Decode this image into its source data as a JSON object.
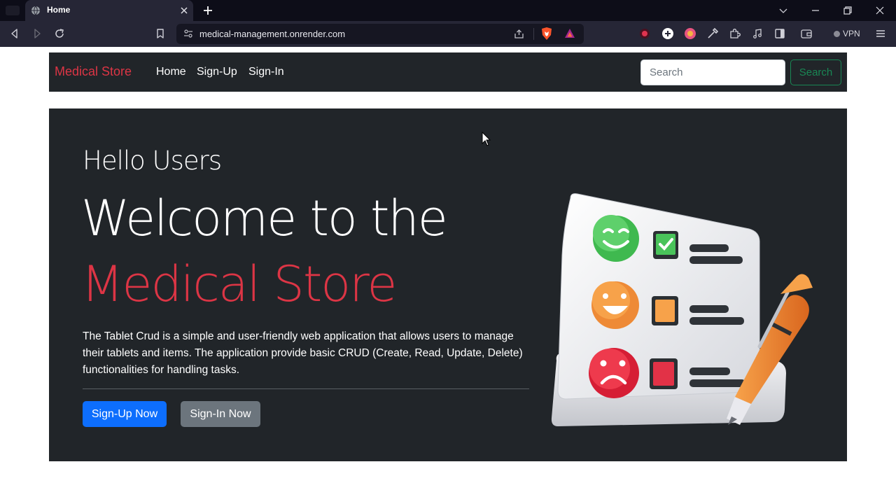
{
  "browser": {
    "tab_title": "Home",
    "url": "medical-management.onrender.com",
    "vpn_label": "VPN"
  },
  "navbar": {
    "brand": "Medical Store",
    "links": [
      "Home",
      "Sign-Up",
      "Sign-In"
    ],
    "search_placeholder": "Search",
    "search_button": "Search"
  },
  "hero": {
    "greeting": "Hello Users",
    "headline_1": "Welcome to the",
    "headline_2": "Medical Store",
    "description": "The Tablet Crud is a simple and user-friendly web application that allows users to manage their tablets and items. The application provide basic CRUD (Create, Read, Update, Delete) functionalities for handling tasks.",
    "primary_button": "Sign-Up Now",
    "secondary_button": "Sign-In Now"
  },
  "colors": {
    "brand": "#dc3545",
    "navbar_bg": "#212529",
    "primary": "#0d6efd",
    "secondary": "#6c757d",
    "success": "#198754"
  },
  "icons": [
    "back-icon",
    "forward-icon",
    "reload-icon",
    "bookmark-icon",
    "site-info-icon",
    "share-icon",
    "brave-shield-icon",
    "brave-rewards-icon",
    "extensions-icon",
    "sidebar-icon",
    "wallet-icon",
    "menu-icon"
  ]
}
